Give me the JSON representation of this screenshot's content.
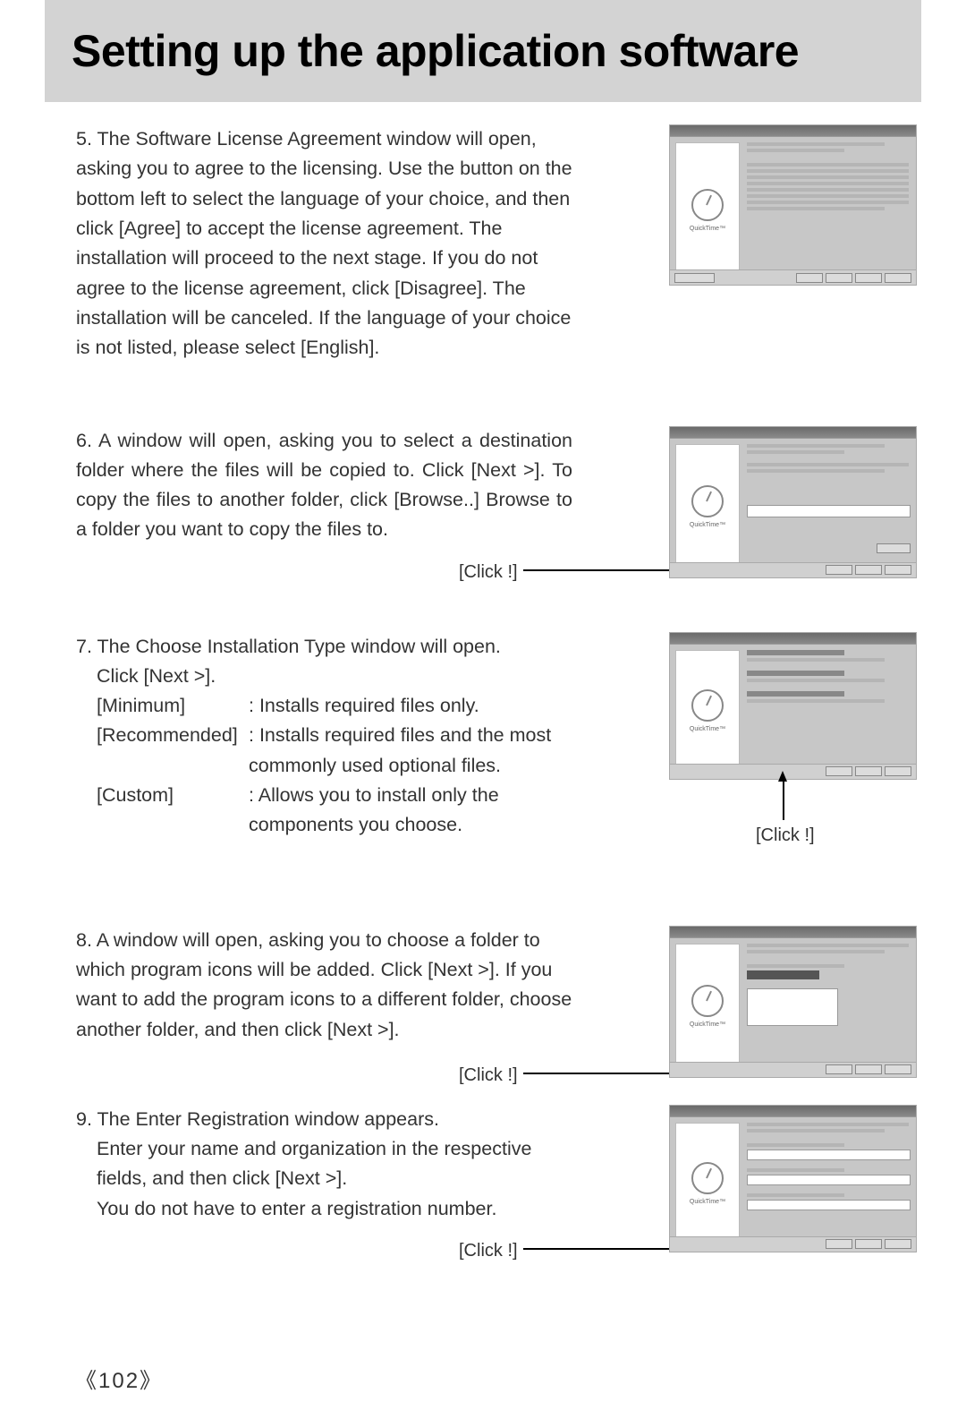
{
  "title": "Setting up the application software",
  "quicktime_label": "QuickTime™",
  "steps": {
    "s5": {
      "num": "5.",
      "text": "The Software License Agreement window will open, asking you to agree to the licensing. Use the button on the bottom left to select the language of your choice, and then click [Agree] to accept the license agreement. The installation will proceed to the next stage. If you do not agree to the license agreement, click [Disagree]. The installation will be canceled. If the language of your choice is not listed, please select [English]."
    },
    "s6": {
      "num": "6.",
      "text": "A window will open, asking you to select a destination folder where the files will be copied to. Click [Next >]. To copy the files to another folder, click [Browse..] Browse to a folder you want to copy the files to.",
      "click": "[Click !]"
    },
    "s7": {
      "num": "7.",
      "line1": "The Choose Installation Type window will open.",
      "line2": "Click [Next >].",
      "opt_min_label": "[Minimum]",
      "opt_min_desc": ": Installs required files only.",
      "opt_rec_label": "[Recommended]",
      "opt_rec_desc1": ": Installs required files and the most",
      "opt_rec_desc2": "commonly used optional files.",
      "opt_cus_label": "[Custom]",
      "opt_cus_desc1": ": Allows you to install only the",
      "opt_cus_desc2": "components you choose.",
      "click": "[Click !]"
    },
    "s8": {
      "num": "8.",
      "text": "A window will open, asking you to choose a folder to which program icons will be added. Click [Next >]. If you want to add the program icons to a different folder, choose another folder, and then click [Next >].",
      "click": "[Click !]"
    },
    "s9": {
      "num": "9.",
      "line1": "The Enter Registration window appears.",
      "line2": "Enter your name and organization in the respective fields, and then click [Next >].",
      "line3": "You do not have to enter a registration number.",
      "click": "[Click !]"
    }
  },
  "page_number": "102"
}
